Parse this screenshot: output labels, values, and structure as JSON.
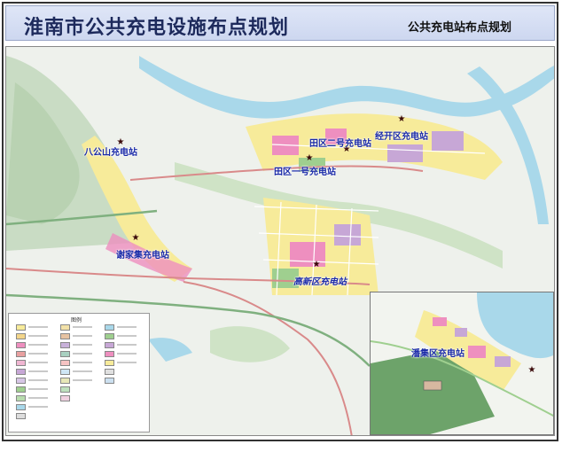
{
  "header": {
    "title": "淮南市公共充电设施布点规划",
    "subtitle": "公共充电站布点规划"
  },
  "map": {
    "stations": [
      {
        "id": "bagongshan",
        "label": "八公山充电站"
      },
      {
        "id": "tianqu2",
        "label": "田区二号充电站"
      },
      {
        "id": "jingkaiqu",
        "label": "经开区充电站"
      },
      {
        "id": "tianqu1",
        "label": "田区一号充电站"
      },
      {
        "id": "xiejiaji",
        "label": "谢家集充电站"
      },
      {
        "id": "gaoxinqu",
        "label": "高新区充电站"
      }
    ],
    "inset": {
      "station": {
        "id": "panji",
        "label": "潘集区充电站"
      }
    },
    "legend": {
      "title": "图例"
    },
    "colors": {
      "river": "#a9d8ea",
      "residential": "#f7eb9a",
      "commercial": "#ee8fbf",
      "industrial": "#c7a7d6",
      "green": "#9fcf8f",
      "road": "#ffffff",
      "station_marker": "#3a0a0a",
      "label_text": "#1a2aa8"
    }
  }
}
